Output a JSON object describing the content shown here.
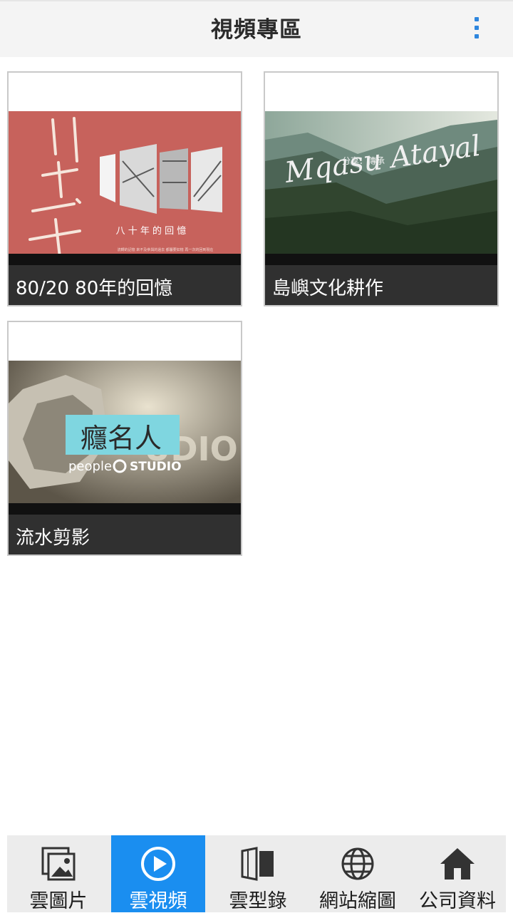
{
  "header": {
    "title": "視頻專區"
  },
  "videos": [
    {
      "caption": "80/20 80年的回憶",
      "thumb_text": "八 十 年 的 回 憶",
      "thumb_small": "流轉的記憶 來不及參與的過去 都屬要如憶 再一次的回到現在"
    },
    {
      "caption": "島嶼文化耕作",
      "thumb_text": "Mqasu Atayal",
      "thumb_small": "分享．傳承"
    },
    {
      "caption": "流水剪影",
      "thumb_text": "癮名人",
      "thumb_small": "people",
      "thumb_brand": "STUDIO"
    }
  ],
  "bottom_nav": [
    {
      "label": "雲圖片",
      "icon": "gallery-icon",
      "active": false
    },
    {
      "label": "雲視頻",
      "icon": "play-icon",
      "active": true
    },
    {
      "label": "雲型錄",
      "icon": "catalog-icon",
      "active": false
    },
    {
      "label": "網站縮圖",
      "icon": "globe-icon",
      "active": false
    },
    {
      "label": "公司資料",
      "icon": "home-icon",
      "active": false
    }
  ],
  "colors": {
    "accent": "#1a8ef0",
    "caption_bg": "#303030",
    "menu_dots": "#2e86de"
  }
}
